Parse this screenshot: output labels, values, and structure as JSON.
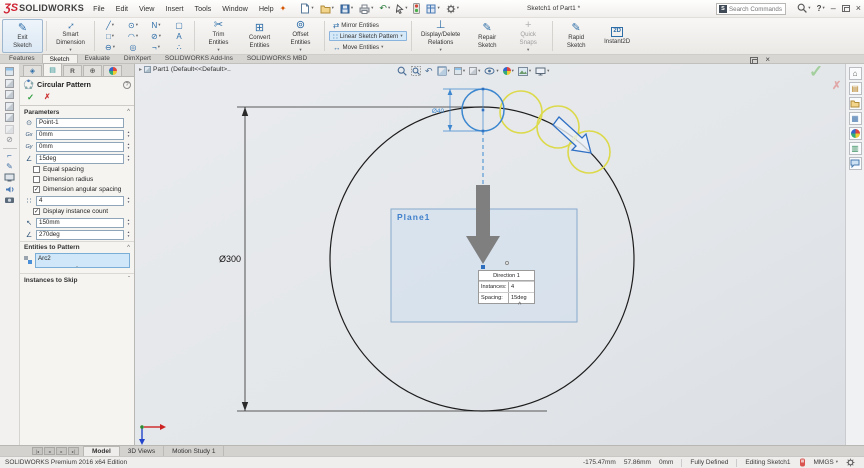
{
  "colors": {
    "selection_blue": "#3c87cf",
    "preview_yellow": "#dcd94a",
    "direction_arrow_gray": "#7f7f7f",
    "plane_fill": "#c7dbf0",
    "plane_label_blue": "#3f7fcb",
    "confirm_green": "#a4cf9e",
    "cancel_red": "#e0a8a8",
    "logo_red": "#cf2030",
    "ribbon_highlight": "#d6e9f8"
  },
  "icons": {
    "caret": "▾",
    "pin": "✦",
    "search_badge": "S",
    "help": "?",
    "minimize": "–",
    "close": "×",
    "check": "✓",
    "cross": "✗",
    "chev_up": "^",
    "chev_down": "ˇ",
    "spin_up": "▴",
    "spin_down": "▾",
    "undo": "↶",
    "menu_arrow": "▸",
    "line": "╱",
    "circle": "⊙",
    "spline": "N",
    "corner_rect": "▢",
    "rect": "□",
    "arc": "◠",
    "ellipse": "⊘",
    "text_tool": "A",
    "slot": "⊖",
    "polygon": "◎",
    "fillet": "¬",
    "point_dots": "∴",
    "mirror": "⇄",
    "linear_pattern": "∷",
    "move": "↔",
    "exit_sketch": "✎",
    "smart_dimension": "↔",
    "trim": "✂",
    "convert": "⊞",
    "offset": "⊚",
    "relations": "⊥",
    "repair": "✎",
    "quick_snaps": "+",
    "rapid": "✎",
    "instant2d_badge": "2D",
    "pm_tab_feature": "◈",
    "pm_tab_property": "▤",
    "pm_tab_config": "R",
    "pm_tab_dimxpert": "⊕",
    "point_ref": "⊙",
    "center_x": "Gx",
    "center_y": "Gy",
    "angle": "∠",
    "instances": "∷",
    "radius": "↖",
    "home": "⌂",
    "design_library": "▤",
    "view_palette": "▦",
    "custom_props": "▥",
    "nav_first": "|◂",
    "nav_prev": "◂",
    "nav_next": "▸",
    "nav_last": "▸|"
  },
  "titlebar": {
    "logo_ds": "ƷS",
    "logo_text": "SOLIDWORKS",
    "menus": [
      "File",
      "Edit",
      "View",
      "Insert",
      "Tools",
      "Window",
      "Help"
    ],
    "document_title": "Sketch1 of Part1 *",
    "search_placeholder": "Search Commands"
  },
  "ribbon": {
    "exit": {
      "a": "Exit",
      "b": "Sketch"
    },
    "smart": {
      "a": "Smart",
      "b": "Dimension"
    },
    "trim": {
      "a": "Trim",
      "b": "Entities"
    },
    "convert": {
      "a": "Convert",
      "b": "Entities"
    },
    "offset": {
      "a": "Offset",
      "b": "Entities"
    },
    "mirror": "Mirror Entities",
    "linear": "Linear Sketch Pattern",
    "move": "Move Entities",
    "disp": {
      "a": "Display/Delete",
      "b": "Relations"
    },
    "repair": {
      "a": "Repair",
      "b": "Sketch"
    },
    "snaps": {
      "a": "Quick",
      "b": "Snaps"
    },
    "rapid": {
      "a": "Rapid",
      "b": "Sketch"
    },
    "instant": "Instant2D"
  },
  "command_tabs": {
    "items": [
      "Features",
      "Sketch",
      "Evaluate",
      "DimXpert",
      "SOLIDWORKS Add-Ins",
      "SOLIDWORKS MBD"
    ],
    "active": "Sketch"
  },
  "property_manager": {
    "title": "Circular Pattern",
    "parameters": {
      "header": "Parameters",
      "point": "Point-1",
      "center_x": "0mm",
      "center_y": "0mm",
      "spacing": "15deg",
      "equal_spacing_label": "Equal spacing",
      "dimension_radius_label": "Dimension radius",
      "dimension_angular_label": "Dimension angular spacing",
      "instances": "4",
      "display_count_label": "Display instance count",
      "radius": "150mm",
      "arc_angle": "270deg"
    },
    "entities": {
      "header": "Entities to Pattern",
      "item": "Arc2"
    },
    "skip": {
      "header": "Instances to Skip"
    }
  },
  "graphics": {
    "breadcrumb": "Part1 (Default<<Default>..",
    "dim_big": "Ø300",
    "dim_small": "Ø40",
    "plane_label": "Plane1",
    "callout": {
      "title": "Direction 1",
      "instances_label": "Instances:",
      "instances_value": "4",
      "spacing_label": "Spacing:",
      "spacing_value": "15deg"
    }
  },
  "bottom": {
    "tabs": [
      "Model",
      "3D Views",
      "Motion Study 1"
    ],
    "active": "Model"
  },
  "statusbar": {
    "edition": "SOLIDWORKS Premium 2016 x64 Edition",
    "x": "-175.47mm",
    "y": "57.86mm",
    "z": "0mm",
    "state": "Fully Defined",
    "mode": "Editing Sketch1",
    "units": "MMGS"
  }
}
